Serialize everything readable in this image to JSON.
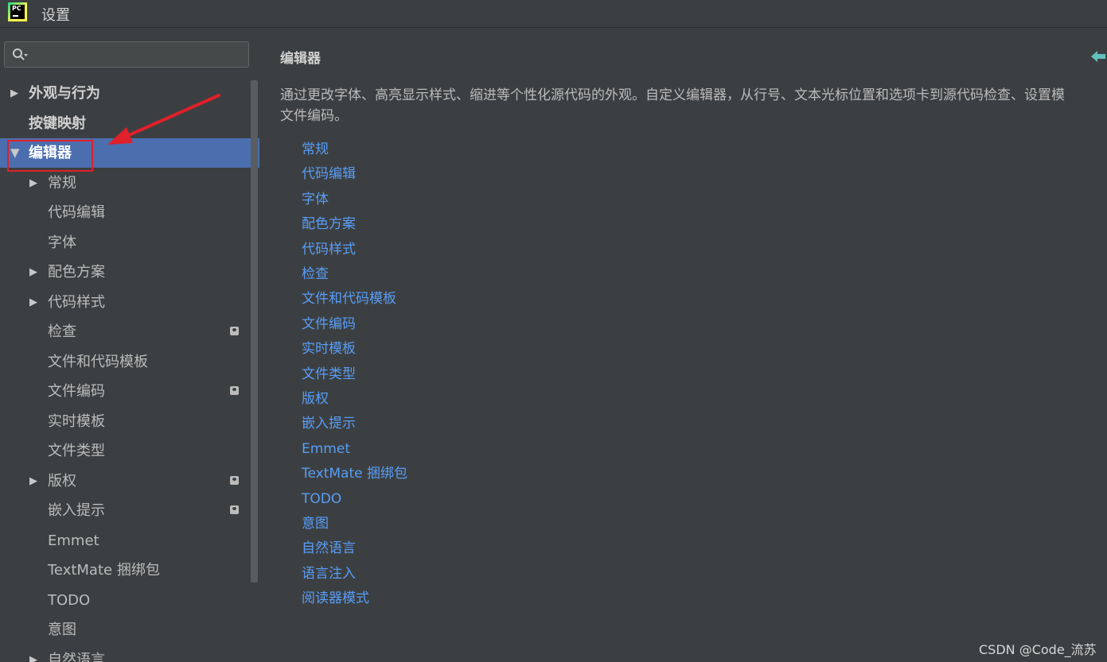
{
  "window": {
    "title": "设置",
    "logo_text": "PC",
    "logo_icon": "pycharm-logo-icon"
  },
  "search": {
    "value": "",
    "placeholder": "",
    "icon": "search-icon"
  },
  "tree": {
    "items": [
      {
        "label": "外观与行为",
        "expandable": true
      },
      {
        "label": "按键映射",
        "expandable": false
      },
      {
        "label": "编辑器",
        "expandable": true,
        "expanded": true,
        "selected": true
      },
      {
        "label": "常规",
        "expandable": true
      },
      {
        "label": "代码编辑",
        "expandable": false
      },
      {
        "label": "字体",
        "expandable": false
      },
      {
        "label": "配色方案",
        "expandable": true
      },
      {
        "label": "代码样式",
        "expandable": true
      },
      {
        "label": "检查",
        "expandable": false,
        "badge": true
      },
      {
        "label": "文件和代码模板",
        "expandable": false
      },
      {
        "label": "文件编码",
        "expandable": false,
        "badge": true
      },
      {
        "label": "实时模板",
        "expandable": false
      },
      {
        "label": "文件类型",
        "expandable": false
      },
      {
        "label": "版权",
        "expandable": true,
        "badge": true
      },
      {
        "label": "嵌入提示",
        "expandable": false,
        "badge": true
      },
      {
        "label": "Emmet",
        "expandable": false
      },
      {
        "label": "TextMate 捆绑包",
        "expandable": false
      },
      {
        "label": "TODO",
        "expandable": false
      },
      {
        "label": "意图",
        "expandable": false
      },
      {
        "label": "自然语言",
        "expandable": true
      }
    ],
    "badge_icon": "project-scope-icon"
  },
  "main": {
    "title": "编辑器",
    "description_line1": "通过更改字体、高亮显示样式、缩进等个性化源代码的外观。自定义编辑器，从行号、文本光标位置和选项卡到源代码检查、设置模",
    "description_line2": "文件编码。",
    "back_icon": "back-arrow-icon",
    "links": [
      "常规",
      "代码编辑",
      "字体",
      "配色方案",
      "代码样式",
      "检查",
      "文件和代码模板",
      "文件编码",
      "实时模板",
      "文件类型",
      "版权",
      "嵌入提示",
      "Emmet",
      "TextMate 捆绑包",
      "TODO",
      "意图",
      "自然语言",
      "语言注入",
      "阅读器模式"
    ]
  },
  "watermark": "CSDN @Code_流苏",
  "colors": {
    "background": "#3c3f41",
    "selection": "#4b6eaf",
    "link": "#589df6",
    "annotation_red": "#e0202a",
    "back_arrow": "#62c0bf"
  }
}
